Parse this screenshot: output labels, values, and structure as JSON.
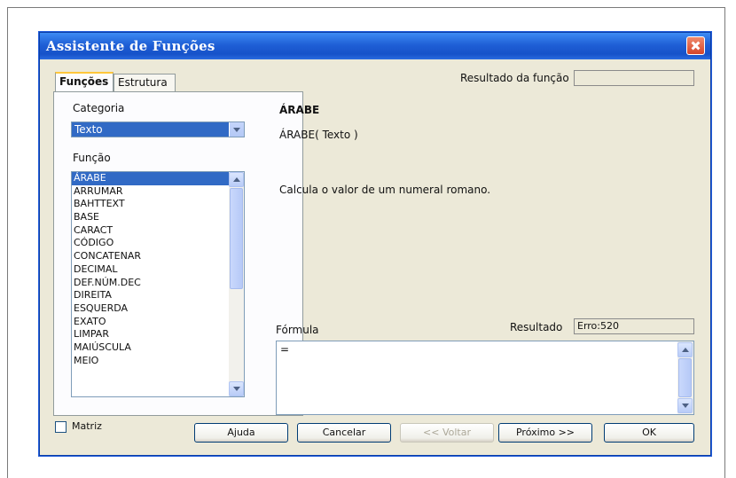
{
  "window": {
    "title": "Assistente de Funções"
  },
  "tabs": [
    {
      "label": "Funções"
    },
    {
      "label": "Estrutura"
    }
  ],
  "category": {
    "label": "Categoria",
    "selected": "Texto"
  },
  "function_list": {
    "label": "Função",
    "items": [
      "ÁRABE",
      "ARRUMAR",
      "BAHTTEXT",
      "BASE",
      "CARACT",
      "CÓDIGO",
      "CONCATENAR",
      "DECIMAL",
      "DEF.NÚM.DEC",
      "DIREITA",
      "ESQUERDA",
      "EXATO",
      "LIMPAR",
      "MAIÚSCULA",
      "MEIO"
    ],
    "selected_index": 0
  },
  "result_function": {
    "label": "Resultado da função",
    "value": ""
  },
  "function_info": {
    "name": "ÁRABE",
    "signature": "ÁRABE( Texto )",
    "description": "Calcula o valor de um numeral romano."
  },
  "formula": {
    "label": "Fórmula",
    "value": "="
  },
  "result": {
    "label": "Resultado",
    "value": "Erro:520"
  },
  "array_checkbox": {
    "label": "Matriz",
    "checked": false
  },
  "buttons": {
    "help": "Ajuda",
    "cancel": "Cancelar",
    "back": "<< Voltar",
    "next": "Próximo >>",
    "ok": "OK"
  }
}
